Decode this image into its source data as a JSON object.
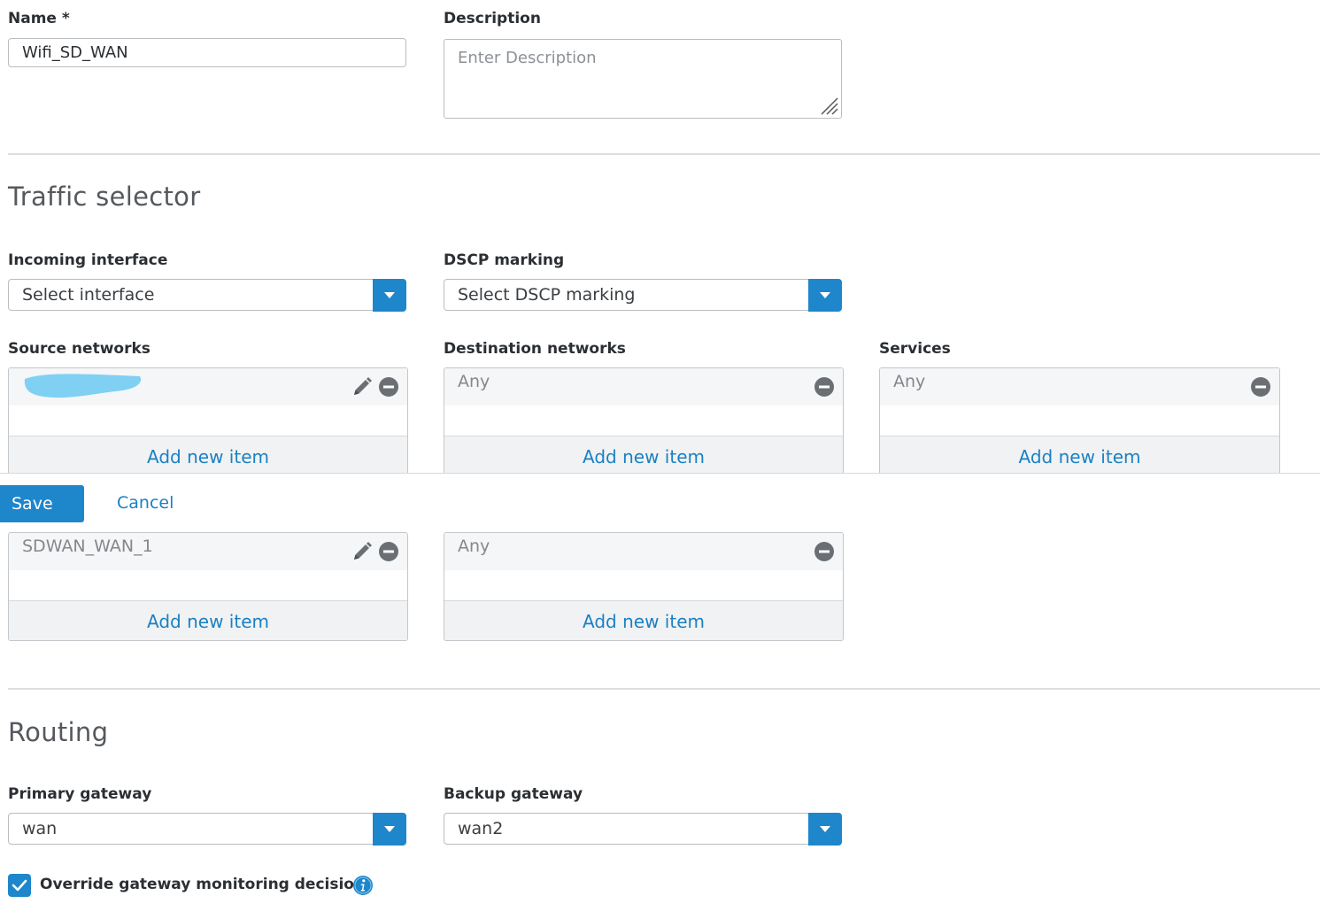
{
  "general": {
    "name_label": "Name *",
    "name_value": "Wifi_SD_WAN",
    "description_label": "Description",
    "description_placeholder": "Enter Description"
  },
  "traffic_selector": {
    "title": "Traffic selector",
    "incoming_interface_label": "Incoming interface",
    "incoming_interface_value": "Select interface",
    "dscp_label": "DSCP marking",
    "dscp_value": "Select DSCP marking",
    "source_networks_label": "Source networks",
    "source_networks_item": "",
    "destination_networks_label": "Destination networks",
    "destination_networks_item": "Any",
    "services_label": "Services",
    "services_item": "Any",
    "add_new_item": "Add new item"
  },
  "lower_lists": {
    "left_item": "SDWAN_WAN_1",
    "right_item": "Any",
    "add_new_item": "Add new item"
  },
  "actions": {
    "save_label": "Save",
    "cancel_label": "Cancel"
  },
  "routing": {
    "title": "Routing",
    "primary_gateway_label": "Primary gateway",
    "primary_gateway_value": "wan",
    "backup_gateway_label": "Backup gateway",
    "backup_gateway_value": "wan2",
    "override_label": "Override gateway monitoring decision",
    "override_checked": true
  },
  "colors": {
    "accent": "#1e86cb",
    "link": "#1a81c4",
    "redaction": "#7fd0f3"
  },
  "icons": [
    "chevron-down-icon",
    "edit-pencil-icon",
    "remove-minus-icon",
    "checkmark-icon",
    "info-icon"
  ]
}
